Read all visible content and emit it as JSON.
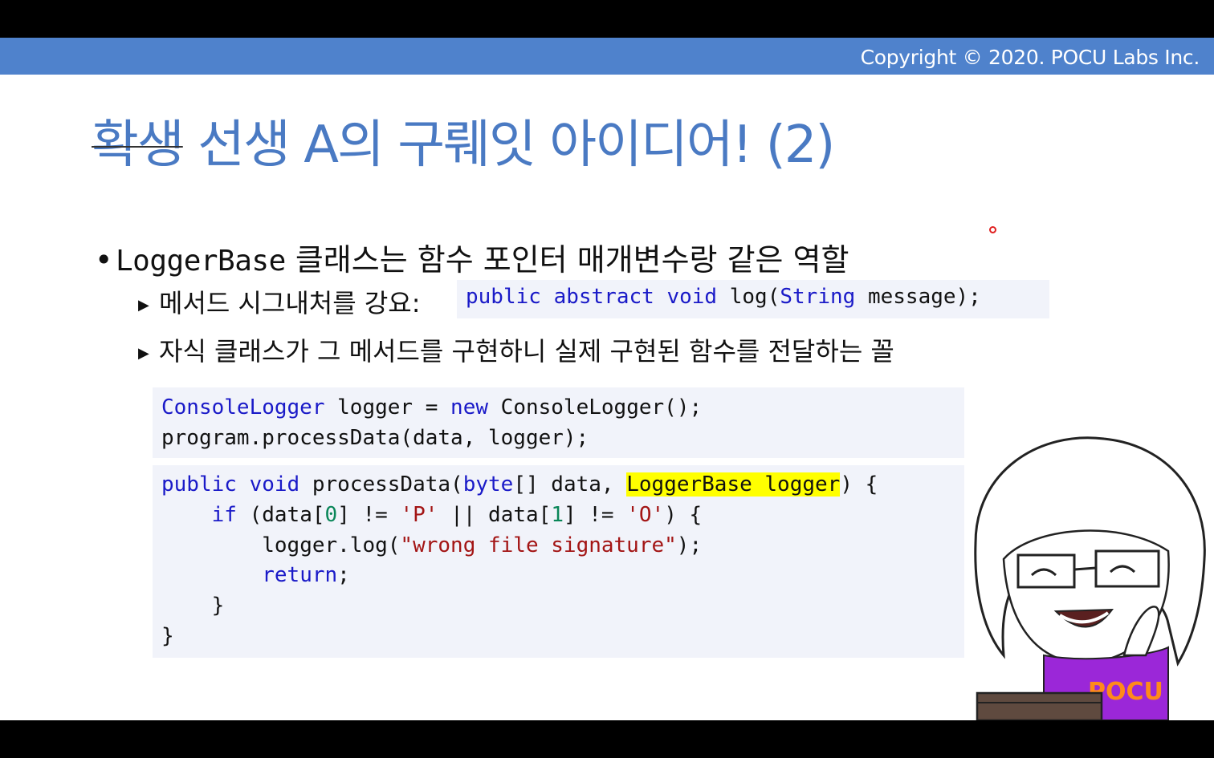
{
  "header": {
    "copyright": "Copyright © 2020. POCU Labs Inc."
  },
  "title": {
    "struck": "확생",
    "rest": " 선생 A의 구뤠잇 아이디어!  (2)"
  },
  "bullet1": {
    "mono": "LoggerBase",
    "text": " 클래스는 함수 포인터 매개변수랑 같은 역할"
  },
  "bullet2": {
    "text": "메서드 시그내처를 강요:"
  },
  "bullet3": {
    "text": "자식 클래스가 그 메서드를 구현하니 실제 구현된 함수를 전달하는 꼴"
  },
  "signature": {
    "kw1": "public",
    "kw2": "abstract",
    "kw3": "void",
    "plain1": " log(",
    "type": "String",
    "plain2": " message);"
  },
  "code1": {
    "l1_type": "ConsoleLogger",
    "l1_mid": " logger = ",
    "l1_kw": "new",
    "l1_end": " ConsoleLogger();",
    "l2": "program.processData(data, logger);"
  },
  "code2": {
    "l1_kw1": "public",
    "l1_kw2": "void",
    "l1_mid": " processData(",
    "l1_type": "byte",
    "l1_mid2": "[] data, ",
    "l1_hl": "LoggerBase logger",
    "l1_end": ") {",
    "l2_indent": "    ",
    "l2_kw": "if",
    "l2_a": " (data[",
    "l2_n0": "0",
    "l2_b": "] != ",
    "l2_s1": "'P'",
    "l2_c": " || data[",
    "l2_n1": "1",
    "l2_d": "] != ",
    "l2_s2": "'O'",
    "l2_e": ") {",
    "l3_indent": "        ",
    "l3_a": "logger.log(",
    "l3_str": "\"wrong file signature\"",
    "l3_b": ");",
    "l4_indent": "        ",
    "l4_kw": "return",
    "l4_b": ";",
    "l5": "    }",
    "l6": "}"
  },
  "character": {
    "shirt_text": "POCU"
  },
  "colors": {
    "accent": "#4f82cc",
    "title": "#4a7ac3",
    "keyword": "#1a1ac8",
    "string": "#a31515",
    "number": "#098658",
    "highlight": "#ffff00",
    "code_bg": "#f1f3fa"
  }
}
